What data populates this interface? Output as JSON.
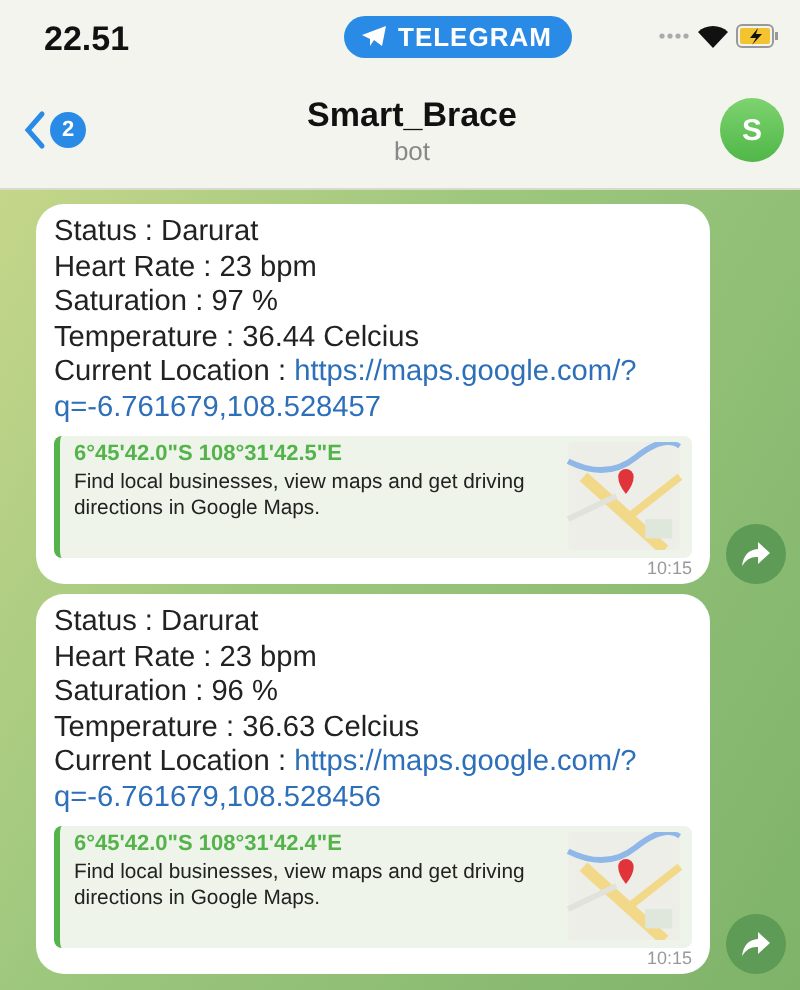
{
  "status_bar": {
    "time": "22.51",
    "app_pill": "TELEGRAM"
  },
  "header": {
    "back_badge": "2",
    "title": "Smart_Brace",
    "subtitle": "bot",
    "avatar": "S"
  },
  "messages": [
    {
      "lines": [
        "Status : Darurat",
        "Heart Rate : 23 bpm",
        "Saturation : 97 %",
        "Temperature : 36.44 Celcius"
      ],
      "location_label": "Current Location :",
      "link_lines": [
        "https://maps.google.com/?",
        "q=-6.761679,108.528457"
      ],
      "preview": {
        "title": "6°45'42.0\"S 108°31'42.5\"E",
        "description": "Find local businesses, view maps and get driving directions in Google Maps."
      },
      "time": "10:15"
    },
    {
      "lines": [
        "Status : Darurat",
        "Heart Rate : 23 bpm",
        "Saturation : 96 %",
        "Temperature : 36.63 Celcius"
      ],
      "location_label": "Current Location :",
      "link_lines": [
        "https://maps.google.com/?",
        "q=-6.761679,108.528456"
      ],
      "preview": {
        "title": "6°45'42.0\"S 108°31'42.4\"E",
        "description": "Find local businesses, view maps and get driving directions in Google Maps."
      },
      "time": "10:15"
    }
  ]
}
